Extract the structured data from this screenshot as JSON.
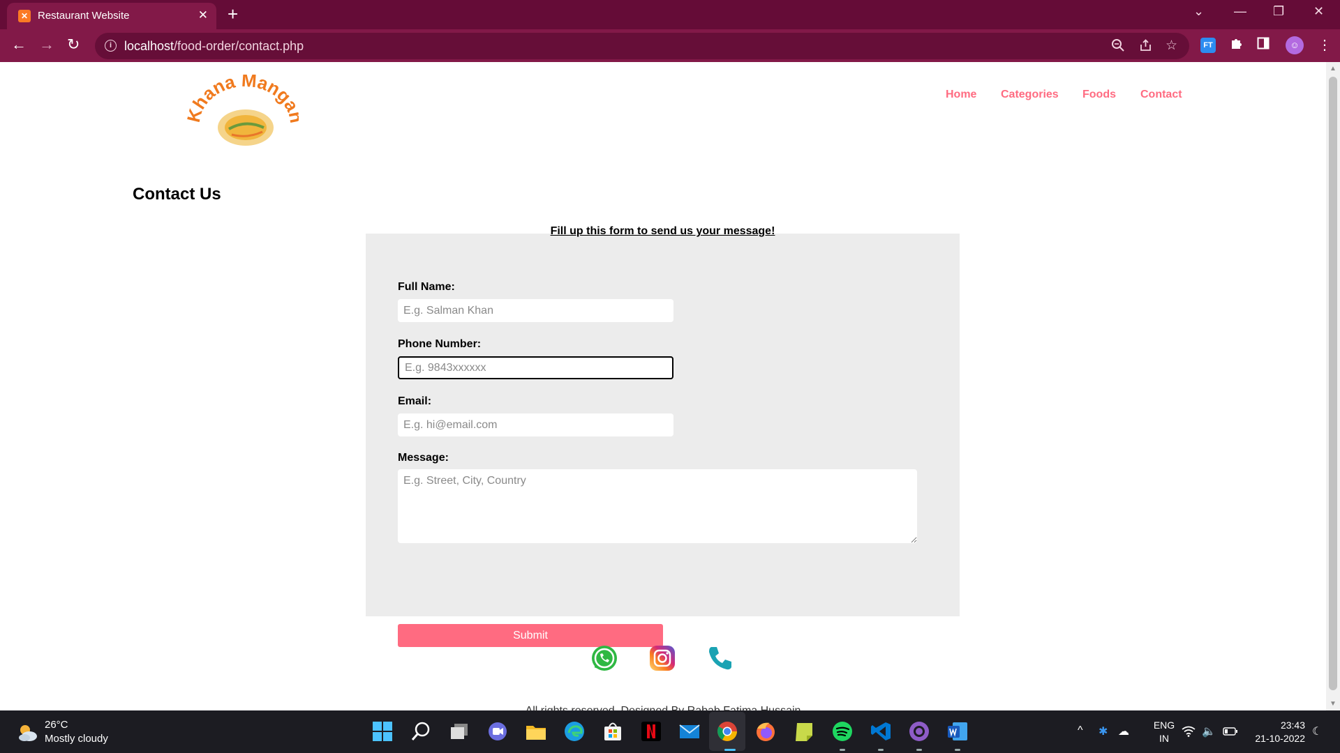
{
  "browser": {
    "tab_title": "Restaurant Website",
    "url_host": "localhost",
    "url_path": "/food-order/contact.php"
  },
  "site": {
    "logo_text": "Khana Mangana!",
    "nav": [
      "Home",
      "Categories",
      "Foods",
      "Contact"
    ],
    "accent_color": "#ff6b81"
  },
  "page": {
    "title": "Contact Us",
    "form_caption": "Fill up this form to send us your message!",
    "fields": {
      "full_name": {
        "label": "Full Name:",
        "placeholder": "E.g. Salman Khan",
        "value": ""
      },
      "phone": {
        "label": "Phone Number:",
        "placeholder": "E.g. 9843xxxxxx",
        "value": ""
      },
      "email": {
        "label": "Email:",
        "placeholder": "E.g. hi@email.com",
        "value": ""
      },
      "message": {
        "label": "Message:",
        "placeholder": "E.g. Street, City, Country",
        "value": ""
      }
    },
    "submit_label": "Submit",
    "social": [
      "whatsapp-icon",
      "instagram-icon",
      "phone-icon"
    ],
    "footer": "All rights reserved. Designed By Rabab Fatima Hussain"
  },
  "taskbar": {
    "weather_temp": "26°C",
    "weather_desc": "Mostly cloudy",
    "lang_1": "ENG",
    "lang_2": "IN",
    "time": "23:43",
    "date": "21-10-2022"
  }
}
